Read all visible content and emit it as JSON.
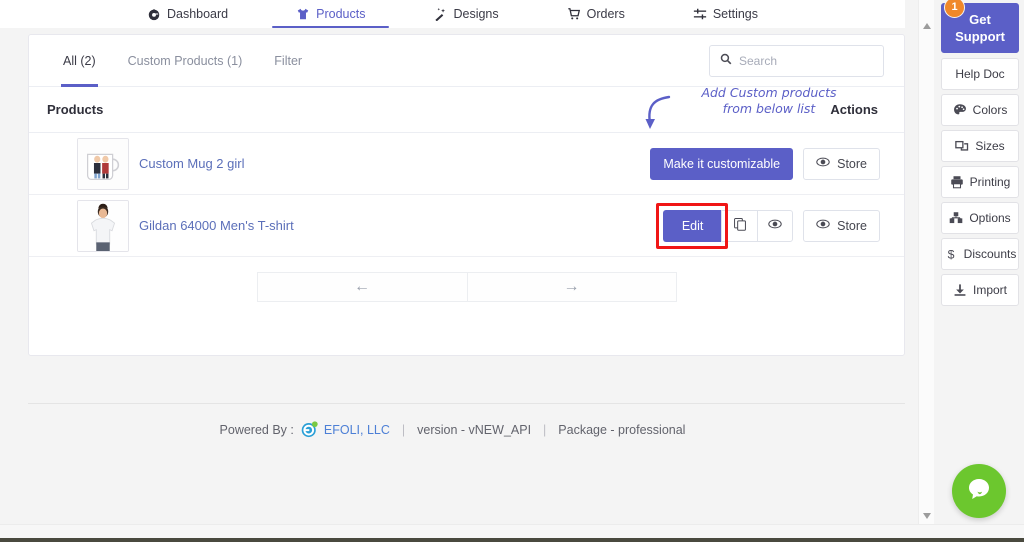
{
  "topnav": {
    "items": [
      {
        "label": "Dashboard",
        "icon": "dashboard-icon",
        "active": false
      },
      {
        "label": "Products",
        "icon": "tshirt-icon",
        "active": true
      },
      {
        "label": "Designs",
        "icon": "magic-wand-icon",
        "active": false
      },
      {
        "label": "Orders",
        "icon": "shopping-cart-icon",
        "active": false
      },
      {
        "label": "Settings",
        "icon": "sliders-icon",
        "active": false
      }
    ]
  },
  "tabs": [
    {
      "label": "All (2)",
      "active": true
    },
    {
      "label": "Custom Products (1)",
      "active": false
    },
    {
      "label": "Filter",
      "active": false
    }
  ],
  "search": {
    "placeholder": "Search",
    "value": "",
    "icon": "search-icon"
  },
  "table": {
    "header_products": "Products",
    "header_actions": "Actions",
    "annotation_line1": "Add Custom products",
    "annotation_line2": "from below list",
    "annotation_color": "#5b5fc7",
    "rows": [
      {
        "name": "Custom Mug 2 girl",
        "thumb": "mug-thumbnail",
        "primary_action": "Make it customizable",
        "store_action": "Store",
        "has_duplicate": false,
        "has_preview": false,
        "highlighted": false
      },
      {
        "name": "Gildan 64000 Men's T-shirt",
        "thumb": "tshirt-thumbnail",
        "primary_action": "Edit",
        "store_action": "Store",
        "has_duplicate": true,
        "has_preview": true,
        "highlighted": true
      }
    ]
  },
  "pagination": {
    "prev": "←",
    "next": "→"
  },
  "footer": {
    "powered_by": "Powered By :",
    "brand": "EFOLI, LLC",
    "version": "version - vNEW_API",
    "package": "Package - professional",
    "separator": "|"
  },
  "sidebar": {
    "support": {
      "line1": "Get",
      "line2": "Support",
      "badge": "1"
    },
    "items": [
      {
        "label": "Help Doc",
        "icon": null
      },
      {
        "label": "Colors",
        "icon": "palette-icon"
      },
      {
        "label": "Sizes",
        "icon": "resize-icon"
      },
      {
        "label": "Printing",
        "icon": "printer-icon"
      },
      {
        "label": "Options",
        "icon": "boxes-icon"
      },
      {
        "label": "Discounts",
        "icon": "dollar-icon"
      },
      {
        "label": "Import",
        "icon": "download-icon"
      }
    ]
  },
  "chat": {
    "icon": "chat-bubble-icon",
    "color": "#6cc72e"
  },
  "colors": {
    "accent": "#5b5fc7",
    "link": "#5b6fb9",
    "highlight": "#f01616",
    "badge": "#f0882a"
  }
}
